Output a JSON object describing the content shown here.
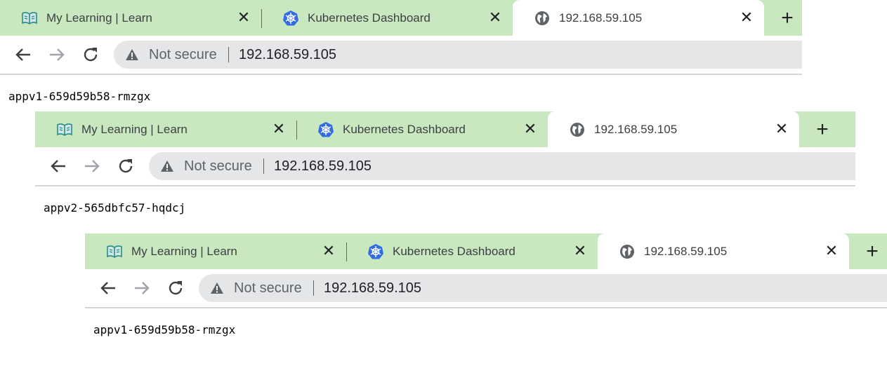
{
  "windows": [
    {
      "tabs": [
        {
          "title": "My Learning | Learn",
          "icon": "book-icon"
        },
        {
          "title": "Kubernetes Dashboard",
          "icon": "kubernetes-icon"
        },
        {
          "title": "192.168.59.105",
          "icon": "globe-icon",
          "active": true
        }
      ],
      "security_label": "Not secure",
      "url": "192.168.59.105",
      "page_text": "appv1-659d59b58-rmzgx"
    },
    {
      "tabs": [
        {
          "title": "My Learning | Learn",
          "icon": "book-icon"
        },
        {
          "title": "Kubernetes Dashboard",
          "icon": "kubernetes-icon"
        },
        {
          "title": "192.168.59.105",
          "icon": "globe-icon",
          "active": true
        }
      ],
      "security_label": "Not secure",
      "url": "192.168.59.105",
      "page_text": "appv2-565dbfc57-hqdcj"
    },
    {
      "tabs": [
        {
          "title": "My Learning | Learn",
          "icon": "book-icon"
        },
        {
          "title": "Kubernetes Dashboard",
          "icon": "kubernetes-icon"
        },
        {
          "title": "192.168.59.105",
          "icon": "globe-icon",
          "active": true
        }
      ],
      "security_label": "Not secure",
      "url": "192.168.59.105",
      "page_text": "appv1-659d59b58-rmzgx"
    }
  ],
  "colors": {
    "tabstrip": "#c9e8c0",
    "omnibox": "#e5e6e8",
    "k8s_blue": "#326ce5",
    "book_teal": "#2b8a8a"
  }
}
